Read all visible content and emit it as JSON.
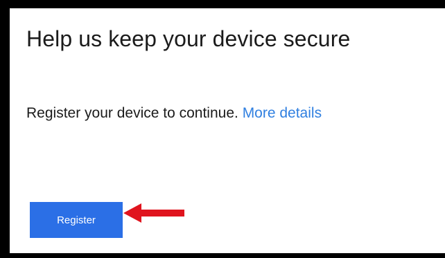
{
  "dialog": {
    "title": "Help us keep your device secure",
    "message": "Register your device to continue.",
    "link_label": "More details",
    "register_label": "Register"
  },
  "colors": {
    "link": "#2f7fe0",
    "button": "#2b6fe6",
    "annotation_arrow": "#e0141e",
    "border": "#000000"
  },
  "annotation": {
    "icon": "red-arrow-pointing-left",
    "target": "register-button"
  }
}
